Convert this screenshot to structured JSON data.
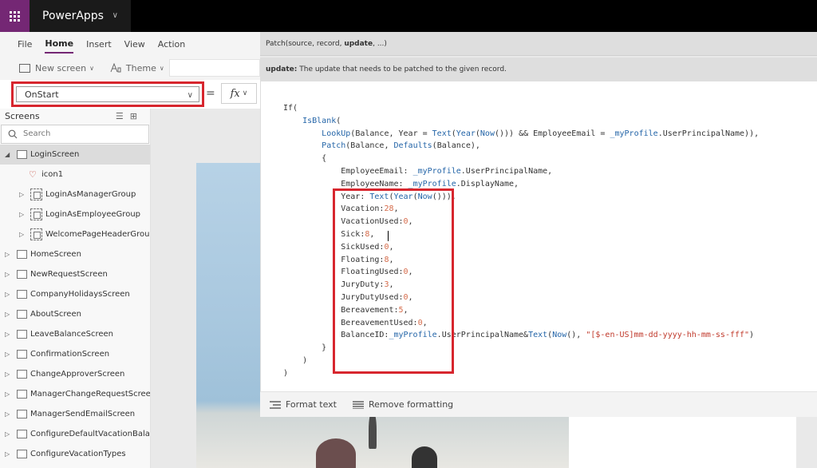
{
  "app": {
    "title": "PowerApps"
  },
  "menu": {
    "items": [
      "File",
      "Home",
      "Insert",
      "View",
      "Action"
    ],
    "active": "Home"
  },
  "tools": {
    "new_screen": "New screen",
    "theme": "Theme"
  },
  "formula_bar": {
    "property": "OnStart",
    "equals": "=",
    "fx": "fx"
  },
  "tree": {
    "header": "Screens",
    "search_placeholder": "Search",
    "items": [
      {
        "label": "LoginScreen",
        "level": 0,
        "expanded": true,
        "selected": true
      },
      {
        "label": "icon1",
        "level": 1,
        "kind": "icon"
      },
      {
        "label": "LoginAsManagerGroup",
        "level": 1,
        "kind": "group"
      },
      {
        "label": "LoginAsEmployeeGroup",
        "level": 1,
        "kind": "group"
      },
      {
        "label": "WelcomePageHeaderGroup",
        "level": 1,
        "kind": "group"
      },
      {
        "label": "HomeScreen",
        "level": 0
      },
      {
        "label": "NewRequestScreen",
        "level": 0
      },
      {
        "label": "CompanyHolidaysScreen",
        "level": 0
      },
      {
        "label": "AboutScreen",
        "level": 0
      },
      {
        "label": "LeaveBalanceScreen",
        "level": 0
      },
      {
        "label": "ConfirmationScreen",
        "level": 0
      },
      {
        "label": "ChangeApproverScreen",
        "level": 0
      },
      {
        "label": "ManagerChangeRequestScreen",
        "level": 0
      },
      {
        "label": "ManagerSendEmailScreen",
        "level": 0
      },
      {
        "label": "ConfigureDefaultVacationBalanceVa",
        "level": 0
      },
      {
        "label": "ConfigureVacationTypes",
        "level": 0
      }
    ]
  },
  "popup": {
    "signature_prefix": "Patch(source, record, ",
    "signature_param": "update",
    "signature_suffix": ", ...)",
    "param_name": "update:",
    "param_desc": " The update that needs to be patched to the given record."
  },
  "code_lines": [
    [
      {
        "t": "If("
      }
    ],
    [
      {
        "t": "    "
      },
      {
        "t": "IsBlank",
        "c": "fn"
      },
      {
        "t": "("
      }
    ],
    [
      {
        "t": "        "
      },
      {
        "t": "LookUp",
        "c": "fn"
      },
      {
        "t": "(Balance, Year = "
      },
      {
        "t": "Text",
        "c": "fn"
      },
      {
        "t": "("
      },
      {
        "t": "Year",
        "c": "fn"
      },
      {
        "t": "("
      },
      {
        "t": "Now",
        "c": "fn"
      },
      {
        "t": "())) && EmployeeEmail = "
      },
      {
        "t": "_myProfile",
        "c": "fn"
      },
      {
        "t": ".UserPrincipalName)),"
      }
    ],
    [
      {
        "t": "        "
      },
      {
        "t": "Patch",
        "c": "fn"
      },
      {
        "t": "(Balance, "
      },
      {
        "t": "Defaults",
        "c": "fn"
      },
      {
        "t": "(Balance),"
      }
    ],
    [
      {
        "t": "        {"
      }
    ],
    [
      {
        "t": "            EmployeeEmail: "
      },
      {
        "t": "_myProfile",
        "c": "fn"
      },
      {
        "t": ".UserPrincipalName,"
      }
    ],
    [
      {
        "t": "            EmployeeName: "
      },
      {
        "t": "_myProfile",
        "c": "fn"
      },
      {
        "t": ".DisplayName,"
      }
    ],
    [
      {
        "t": "            Year: "
      },
      {
        "t": "Text",
        "c": "fn"
      },
      {
        "t": "("
      },
      {
        "t": "Year",
        "c": "fn"
      },
      {
        "t": "("
      },
      {
        "t": "Now",
        "c": "fn"
      },
      {
        "t": "())),"
      }
    ],
    [
      {
        "t": "            Vacation:"
      },
      {
        "t": "28",
        "c": "num"
      },
      {
        "t": ","
      }
    ],
    [
      {
        "t": "            VacationUsed:"
      },
      {
        "t": "0",
        "c": "num"
      },
      {
        "t": ","
      }
    ],
    [
      {
        "t": "            Sick:"
      },
      {
        "t": "8",
        "c": "num"
      },
      {
        "t": ","
      }
    ],
    [
      {
        "t": "            SickUsed:"
      },
      {
        "t": "0",
        "c": "num"
      },
      {
        "t": ","
      }
    ],
    [
      {
        "t": "            Floating:"
      },
      {
        "t": "8",
        "c": "num"
      },
      {
        "t": ","
      }
    ],
    [
      {
        "t": "            FloatingUsed:"
      },
      {
        "t": "0",
        "c": "num"
      },
      {
        "t": ","
      }
    ],
    [
      {
        "t": "            JuryDuty:"
      },
      {
        "t": "3",
        "c": "num"
      },
      {
        "t": ","
      }
    ],
    [
      {
        "t": "            JuryDutyUsed:"
      },
      {
        "t": "0",
        "c": "num"
      },
      {
        "t": ","
      }
    ],
    [
      {
        "t": "            Bereavement:"
      },
      {
        "t": "5",
        "c": "num"
      },
      {
        "t": ","
      }
    ],
    [
      {
        "t": "            BereavementUsed:"
      },
      {
        "t": "0",
        "c": "num"
      },
      {
        "t": ","
      }
    ],
    [
      {
        "t": "            BalanceID:"
      },
      {
        "t": "_myProfile",
        "c": "fn"
      },
      {
        "t": ".UserPrincipalName&"
      },
      {
        "t": "Text",
        "c": "fn"
      },
      {
        "t": "("
      },
      {
        "t": "Now",
        "c": "fn"
      },
      {
        "t": "(), "
      },
      {
        "t": "\"[$-en-US]mm-dd-yyyy-hh-mm-ss-fff\"",
        "c": "str"
      },
      {
        "t": ")"
      }
    ],
    [
      {
        "t": "        }"
      }
    ],
    [
      {
        "t": "    )"
      }
    ],
    [
      {
        "t": ")"
      }
    ]
  ],
  "footer": {
    "format_text": "Format text",
    "remove_formatting": "Remove formatting"
  },
  "colors": {
    "brand": "#742774",
    "highlight": "#d7262e",
    "function": "#2465a8",
    "number": "#d56b4a",
    "string": "#c0392b"
  }
}
